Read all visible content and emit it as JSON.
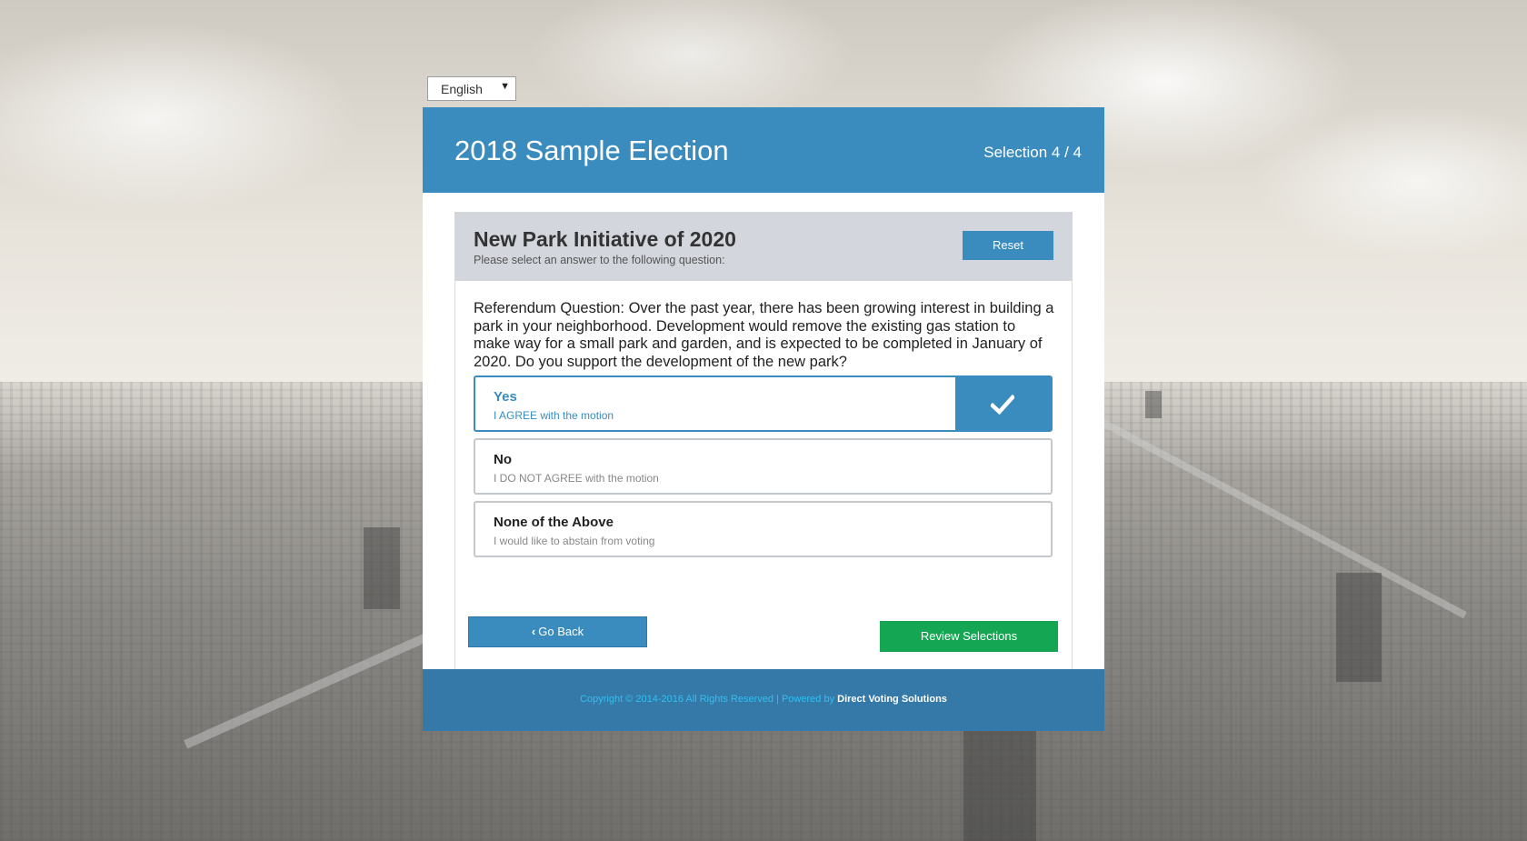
{
  "language": {
    "selected": "English"
  },
  "header": {
    "title": "2018 Sample Election",
    "progress": "Selection 4 / 4"
  },
  "question": {
    "title": "New Park Initiative of 2020",
    "subtitle": "Please select an answer to the following question:",
    "reset_label": "Reset",
    "text": "Referendum Question: Over the past year, there has been growing interest in building a park in your neighborhood. Development would remove the existing gas station to make way for a small park and garden, and is expected to be completed in January of 2020. Do you support the development of the new park?",
    "options": [
      {
        "label": "Yes",
        "description": "I AGREE with the motion",
        "selected": true
      },
      {
        "label": "No",
        "description": "I DO NOT AGREE with the motion",
        "selected": false
      },
      {
        "label": "None of the Above",
        "description": "I would like to abstain from voting",
        "selected": false
      }
    ]
  },
  "actions": {
    "back_label": "Go Back",
    "review_label": "Review Selections"
  },
  "footer": {
    "copyright": "Copyright © 2014-2016 All Rights Reserved | Powered by ",
    "brand": "Direct Voting Solutions"
  },
  "colors": {
    "primary": "#3a8bbe",
    "success": "#14a652",
    "footer": "#3579a8",
    "footer_text": "#31bff0"
  },
  "icons": {
    "selected_check": "checkmark-icon",
    "back": "chevron-left-icon",
    "language_dropdown": "caret-down-icon"
  }
}
